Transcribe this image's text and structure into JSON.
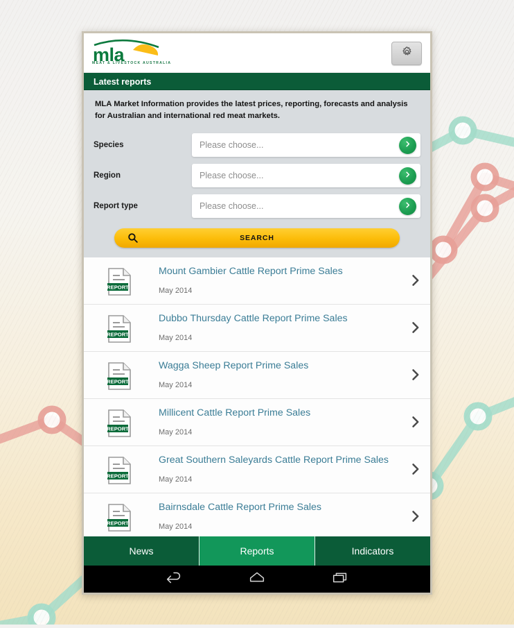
{
  "app": {
    "logo_text": "mla",
    "logo_tagline": "MEAT & LIVESTOCK AUSTRALIA",
    "settings_icon": "gear-icon",
    "accent_green": "#0b5c38",
    "active_tab_green": "#12975a",
    "link_blue": "#3b7d96",
    "search_yellow": "#fcbd0a"
  },
  "section": {
    "title": "Latest reports",
    "description": "MLA Market Information provides the latest prices, reporting, forecasts and analysis for Australian and international red meat markets."
  },
  "form": {
    "fields": [
      {
        "label": "Species",
        "value": "",
        "placeholder": "Please choose...",
        "go_icon": "chevron-right-icon"
      },
      {
        "label": "Region",
        "value": "",
        "placeholder": "Please choose...",
        "go_icon": "chevron-right-icon"
      },
      {
        "label": "Report type",
        "value": "",
        "placeholder": "Please choose...",
        "go_icon": "chevron-right-icon"
      }
    ],
    "search_button": {
      "label": "SEARCH",
      "icon": "search-icon"
    }
  },
  "reports": [
    {
      "title": "Mount Gambier Cattle Report Prime Sales",
      "date": "May 2014",
      "badge": "REPORT"
    },
    {
      "title": "Dubbo Thursday Cattle Report Prime Sales",
      "date": "May 2014",
      "badge": "REPORT"
    },
    {
      "title": "Wagga Sheep Report Prime Sales",
      "date": "May 2014",
      "badge": "REPORT"
    },
    {
      "title": "Millicent Cattle Report Prime Sales",
      "date": "May 2014",
      "badge": "REPORT"
    },
    {
      "title": "Great Southern Saleyards Cattle Report Prime Sales",
      "date": "May 2014",
      "badge": "REPORT"
    },
    {
      "title": "Bairnsdale Cattle Report Prime Sales",
      "date": "May 2014",
      "badge": "REPORT"
    }
  ],
  "tabs": [
    {
      "label": "News",
      "active": false
    },
    {
      "label": "Reports",
      "active": true
    },
    {
      "label": "Indicators",
      "active": false
    }
  ],
  "navbar": {
    "back": "back-icon",
    "home": "home-icon",
    "recents": "recents-icon"
  }
}
